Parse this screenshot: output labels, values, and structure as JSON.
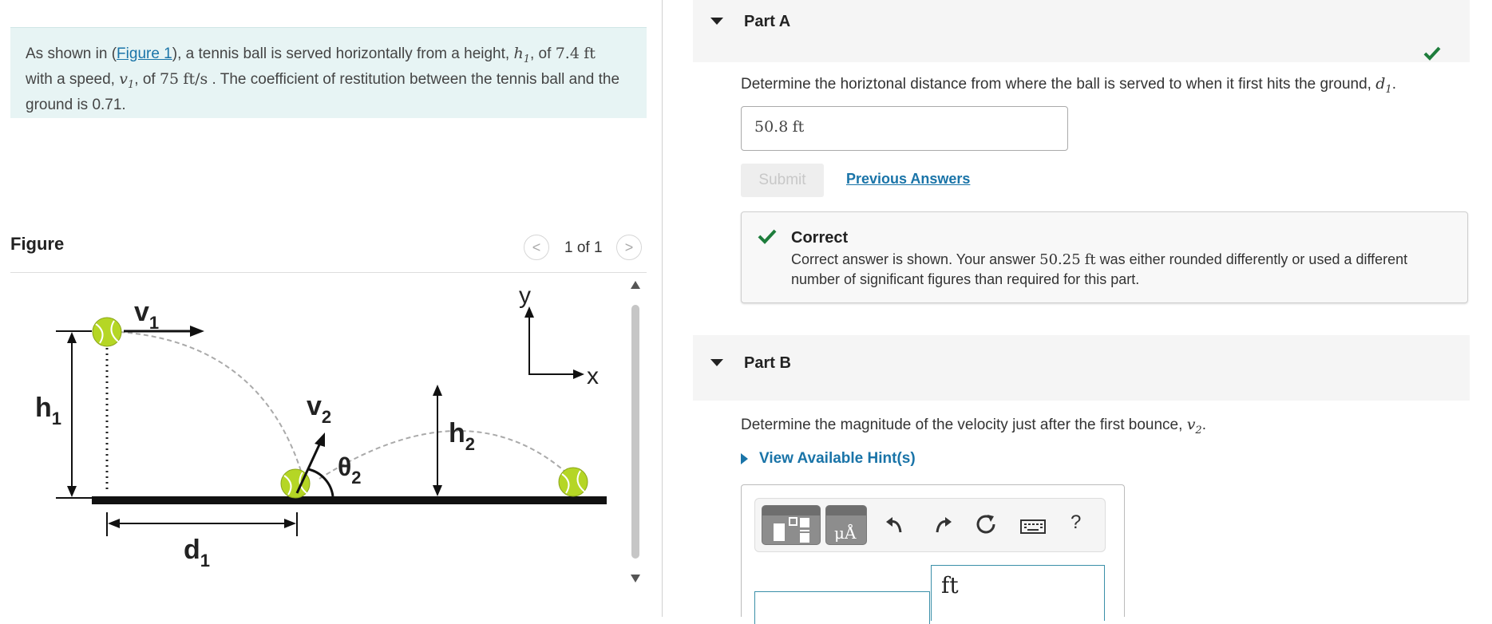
{
  "problem": {
    "text_1": "As shown in (",
    "figure_link": "Figure 1",
    "text_2": "), a tennis ball is served horizontally from a height, ",
    "h1_symbol": "h",
    "h1_sub": "1",
    "text_3": ", of ",
    "h1_value": "7.4",
    "h1_unit": "ft",
    "text_4": "with a speed, ",
    "v1_symbol": "v",
    "v1_sub": "1",
    "text_5": ", of ",
    "v1_value": "75",
    "v1_unit": "ft/s",
    "text_6": ". The coefficient of restitution between the tennis ball and the ground is 0.71."
  },
  "figure": {
    "heading": "Figure",
    "counter": "1 of 1",
    "prev_glyph": "<",
    "next_glyph": ">",
    "labels": {
      "v1": "v",
      "v1_sub": "1",
      "h1": "h",
      "h1_sub": "1",
      "v2": "v",
      "v2_sub": "2",
      "theta2": "θ",
      "theta2_sub": "2",
      "h2": "h",
      "h2_sub": "2",
      "d1": "d",
      "d1_sub": "1",
      "axis_y": "y",
      "axis_x": "x"
    }
  },
  "part_a": {
    "title": "Part A",
    "question_prefix": "Determine the horiztonal distance from where the ball is served to when it first hits the ground, ",
    "question_symbol": "d",
    "question_sub": "1",
    "question_suffix": ".",
    "answer_value": "50.8",
    "answer_unit": "ft",
    "submit_label": "Submit",
    "previous_answers_label": "Previous Answers",
    "feedback_title": "Correct",
    "feedback_text_1": "Correct answer is shown. Your answer ",
    "feedback_value": "50.25",
    "feedback_unit": "ft",
    "feedback_text_2": " was either rounded differently or used a different number of significant figures than required for this part.",
    "status_color": "#1e7d3c"
  },
  "part_b": {
    "title": "Part B",
    "question_prefix": "Determine the magnitude of the velocity just after the first bounce, ",
    "question_symbol": "v",
    "question_sub": "2",
    "question_suffix": ".",
    "hints_label": "View Available Hint(s)",
    "units_button_label": "μÅ",
    "help_label": "?",
    "unit_value": "ft"
  },
  "colors": {
    "link": "#1a74a8",
    "problem_bg": "#e7f4f4",
    "ball": "#b5d625"
  }
}
